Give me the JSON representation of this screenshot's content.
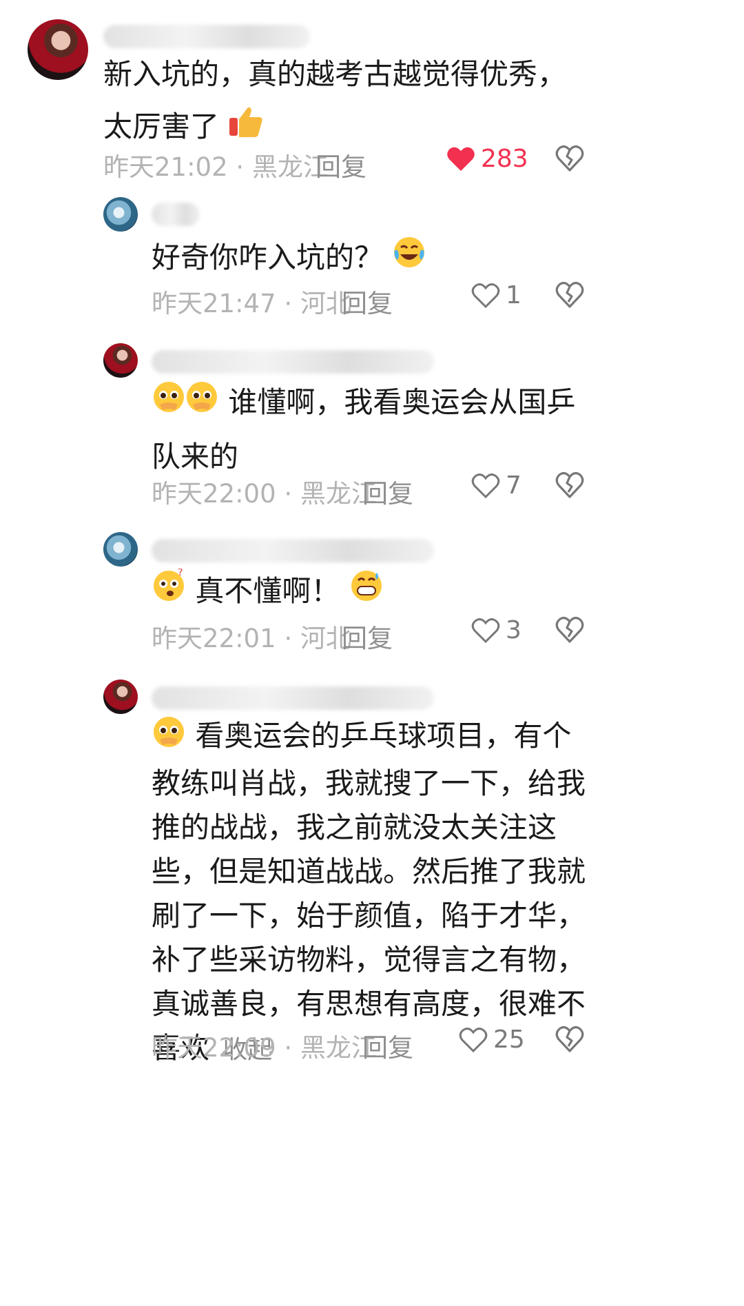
{
  "comments": [
    {
      "text": "新入坑的，真的越考古越觉得优秀，太厉害了",
      "time": "昨天21:02",
      "location": "黑龙江",
      "reply": "回复",
      "likes": "283"
    },
    {
      "text": "好奇你咋入坑的？",
      "time": "昨天21:47",
      "location": "河北",
      "reply": "回复",
      "likes": "1"
    },
    {
      "text": "谁懂啊，我看奥运会从国乒队来的",
      "time": "昨天22:00",
      "location": "黑龙江",
      "reply": "回复",
      "likes": "7"
    },
    {
      "text": "真不懂啊！",
      "time": "昨天22:01",
      "location": "河北",
      "reply": "回复",
      "likes": "3"
    },
    {
      "text": "看奥运会的乒乓球项目，有个教练叫肖战，我就搜了一下，给我推的战战，我之前就没太关注这些，但是知道战战。然后推了我就刷了一下，始于颜值，陷于才华，补了些采访物料，觉得言之有物，真诚善良，有思想有高度，很难不喜欢",
      "collapse": "收起",
      "time": "昨天22:09",
      "location": "黑龙江",
      "reply": "回复",
      "likes": "25"
    }
  ],
  "separator": " · ",
  "colors": {
    "liked_heart": "#f2304f",
    "meta": "#b3b3b3"
  }
}
